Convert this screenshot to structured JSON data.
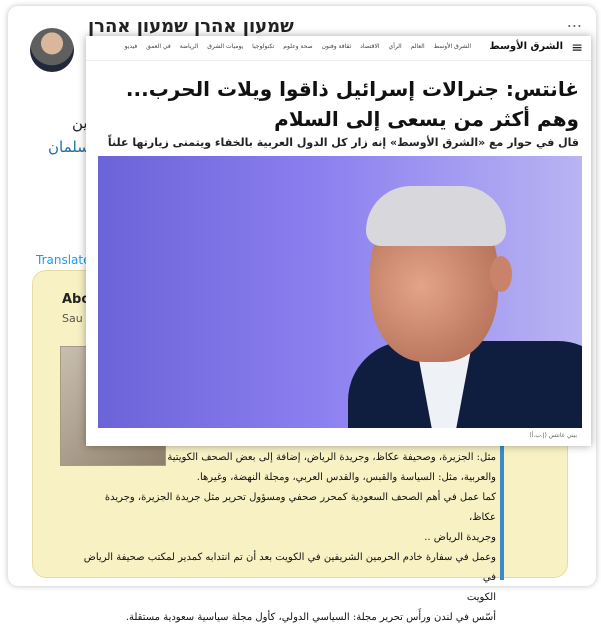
{
  "background": {
    "author_name": "שמעון אהרן שמעון אהרן",
    "more_label": "...",
    "side_text_1": "ين",
    "side_text_2": "سلمان",
    "translate_label": "Translate",
    "quoted_post": {
      "author_name": "Abo",
      "author_handle": "Sau",
      "body_lines": [
        "مثل: الجزيرة، وصحيفة عكاظ، وجريدة الرياض، إضافة إلى بعض الصحف الكويتية",
        "والعربية، مثل: السياسة والقبس، والقدس العربي، ومجلة النهضة، وغيرها.",
        "كما عمل في أهم الصحف السعودية كمحرر صحفي ومسؤول تحرير مثل جريدة الجزيرة، وجريدة عكاظ،",
        "وجريدة الرياض ..",
        "وعمل في سفارة خادم الحرمين الشريفين في الكويت بعد أن تم انتدابه كمدير لمكتب صحيفة الرياض في",
        "الكويت",
        "أسّس في لندن ورأَس تحرير مجلة: السياسي الدولي، كأول مجلة سياسية سعودية مستقلة."
      ]
    }
  },
  "article": {
    "menu_icon": "≡",
    "logo": "الشرق الأوسط",
    "nav_links": [
      "الشرق الأوسط",
      "العالم",
      "الرأي",
      "الاقتصاد",
      "ثقافة وفنون",
      "صحة وعلوم",
      "تكنولوجيا",
      "يوميات الشرق",
      "الرياضة",
      "في العمق",
      "فيديو"
    ],
    "headline": "غانتس: جنرالات إسرائيل ذاقوا ويلات الحرب... وهم أكثر من يسعى إلى السلام",
    "subheadline": "قال في حوار مع «الشرق الأوسط» إنه زار كل الدول العربية بالخفاء ويتمنى زيارتها علناً",
    "photo_caption": "بيني غانتس (إ.ب.أ)"
  }
}
